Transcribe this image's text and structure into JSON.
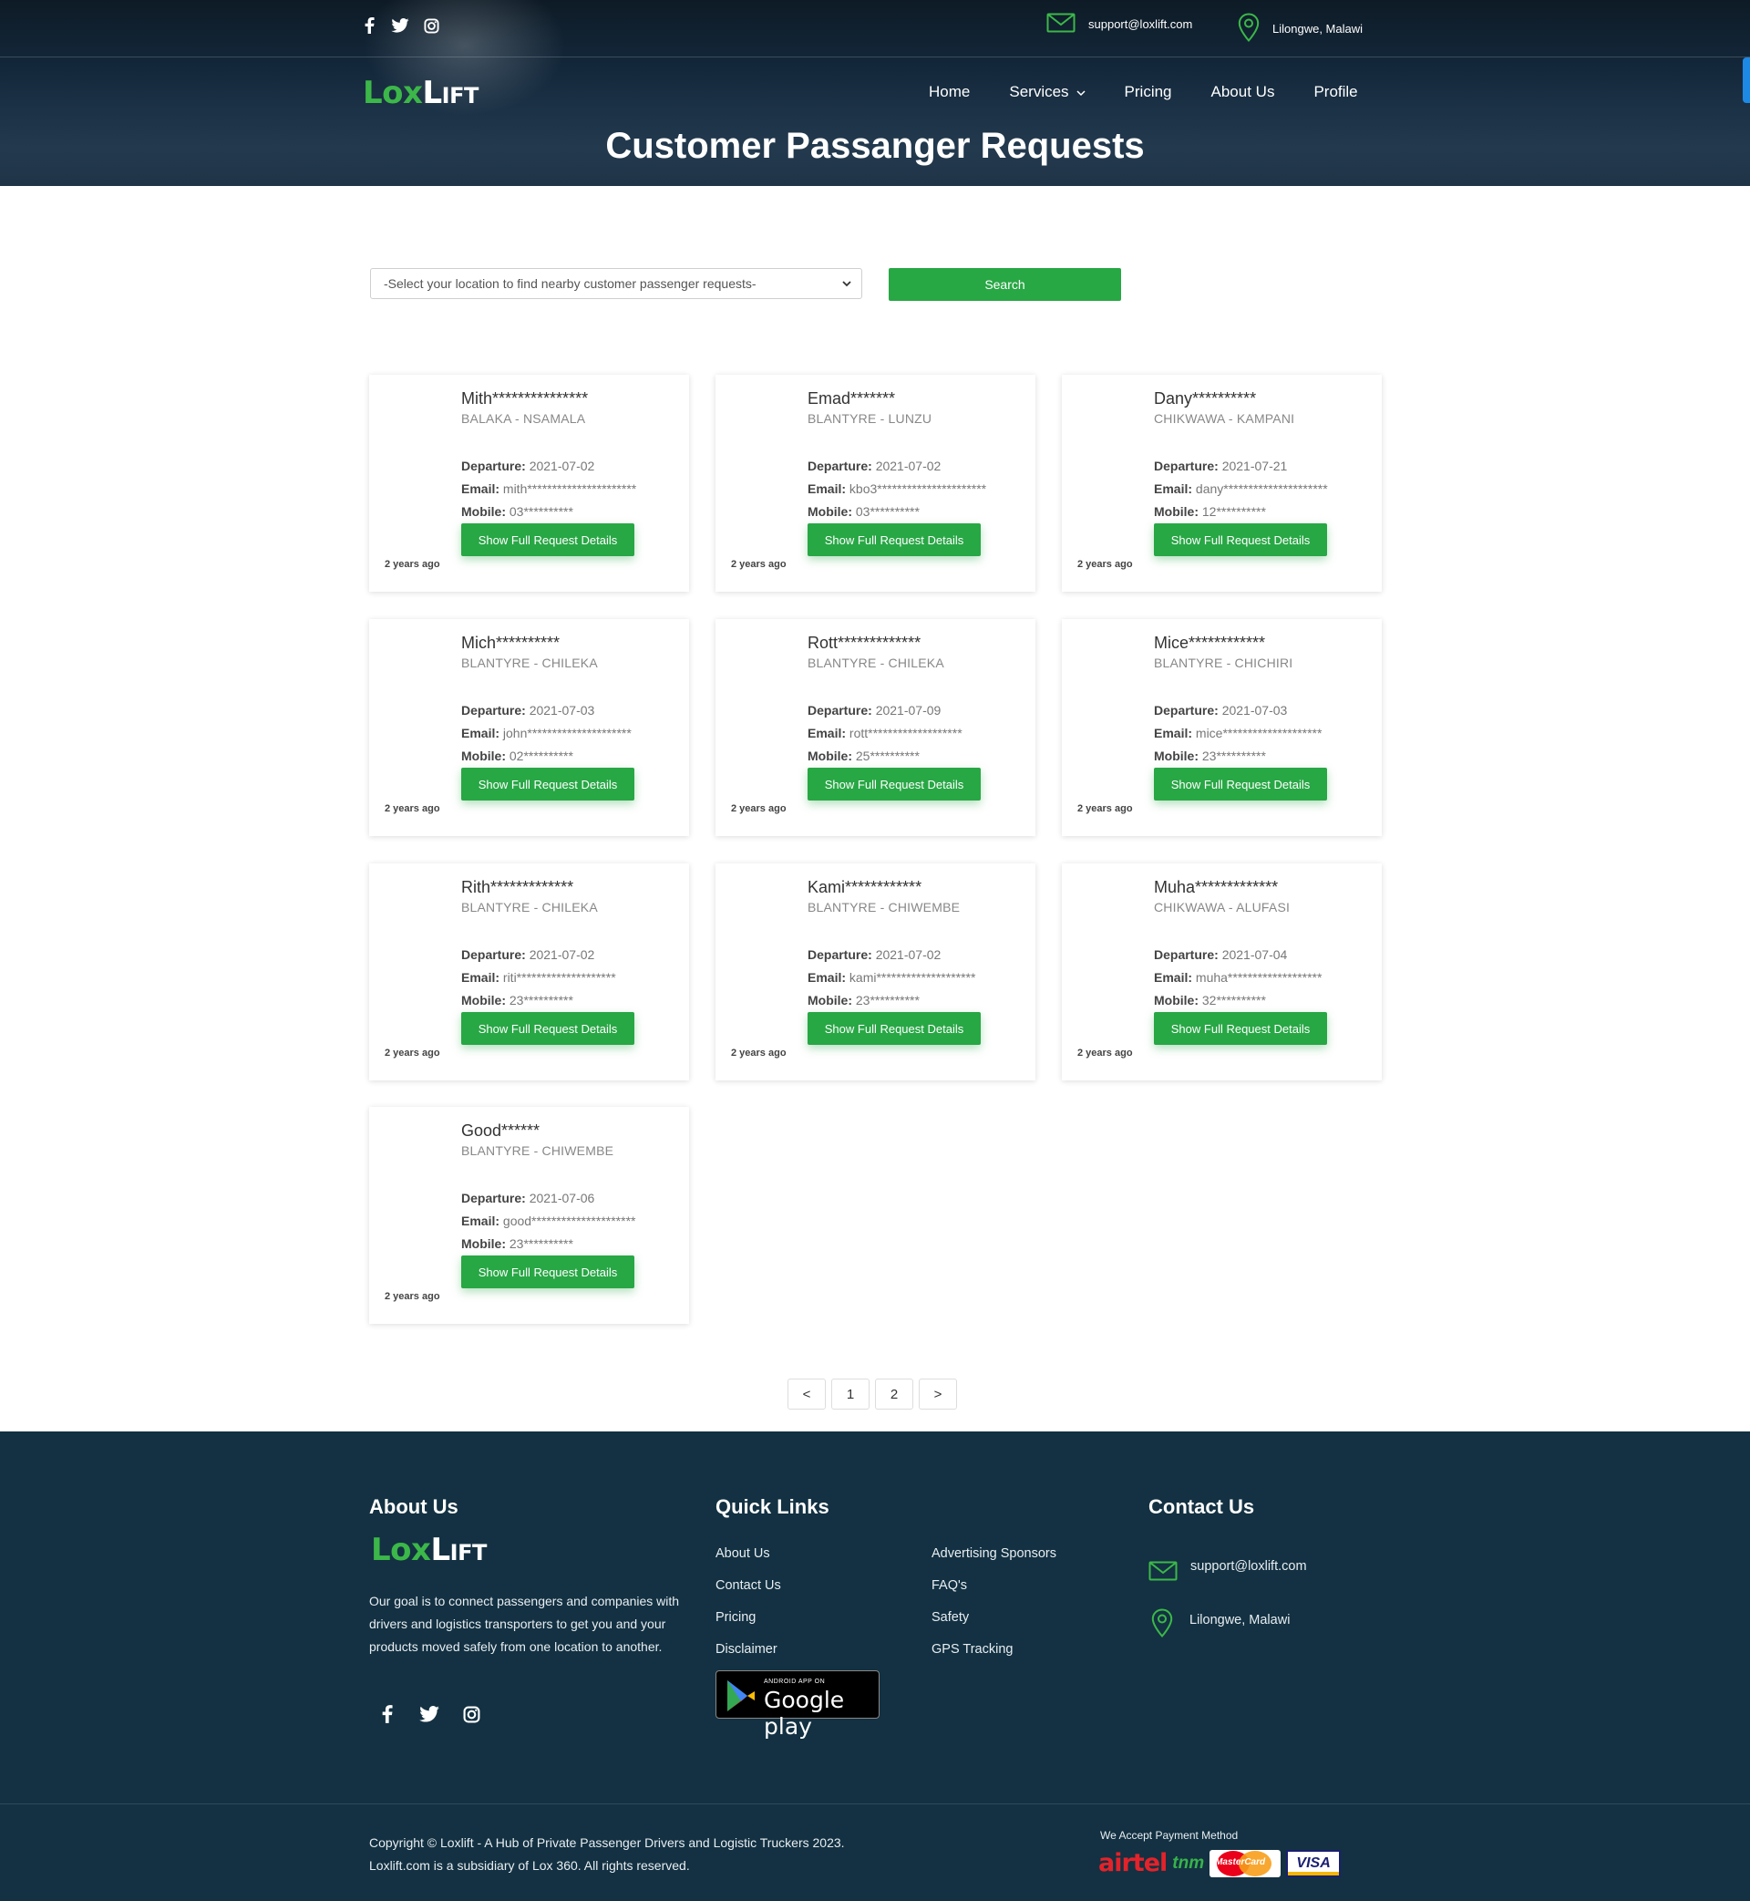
{
  "topbar": {
    "email": "support@loxlift.com",
    "location": "Lilongwe, Malawi",
    "social": [
      "facebook-icon",
      "twitter-icon",
      "instagram-icon"
    ]
  },
  "brand": {
    "lox": "Lox",
    "lift": "Lift"
  },
  "nav": {
    "home": "Home",
    "services": "Services",
    "pricing": "Pricing",
    "about": "About Us",
    "profile": "Profile"
  },
  "page": {
    "title": "Customer Passanger Requests"
  },
  "search": {
    "select_value": "-Select your location to find nearby customer passenger requests-",
    "button": "Search"
  },
  "labels": {
    "departure": "Departure:",
    "email": "Email:",
    "mobile": "Mobile:",
    "details_button": "Show Full Request Details"
  },
  "requests": [
    {
      "name": "Mith***************",
      "route": "BALAKA - NSAMALA",
      "departure": "2021-07-02",
      "email": "mith**********************",
      "mobile": "03**********",
      "ago": "2 years ago"
    },
    {
      "name": "Emad*******",
      "route": "BLANTYRE - LUNZU",
      "departure": "2021-07-02",
      "email": "kbo3**********************",
      "mobile": "03**********",
      "ago": "2 years ago"
    },
    {
      "name": "Dany**********",
      "route": "CHIKWAWA - KAMPANI",
      "departure": "2021-07-21",
      "email": "dany*********************",
      "mobile": "12**********",
      "ago": "2 years ago"
    },
    {
      "name": "Mich**********",
      "route": "BLANTYRE - CHILEKA",
      "departure": "2021-07-03",
      "email": "john*********************",
      "mobile": "02**********",
      "ago": "2 years ago"
    },
    {
      "name": "Rott*************",
      "route": "BLANTYRE - CHILEKA",
      "departure": "2021-07-09",
      "email": "rott*******************",
      "mobile": "25**********",
      "ago": "2 years ago"
    },
    {
      "name": "Mice************",
      "route": "BLANTYRE - CHICHIRI",
      "departure": "2021-07-03",
      "email": "mice********************",
      "mobile": "23**********",
      "ago": "2 years ago"
    },
    {
      "name": "Rith*************",
      "route": "BLANTYRE - CHILEKA",
      "departure": "2021-07-02",
      "email": "riti********************",
      "mobile": "23**********",
      "ago": "2 years ago"
    },
    {
      "name": "Kami************",
      "route": "BLANTYRE - CHIWEMBE",
      "departure": "2021-07-02",
      "email": "kami********************",
      "mobile": "23**********",
      "ago": "2 years ago"
    },
    {
      "name": "Muha*************",
      "route": "CHIKWAWA - ALUFASI",
      "departure": "2021-07-04",
      "email": "muha*******************",
      "mobile": "32**********",
      "ago": "2 years ago"
    },
    {
      "name": "Good******",
      "route": "BLANTYRE - CHIWEMBE",
      "departure": "2021-07-06",
      "email": "good*********************",
      "mobile": "23**********",
      "ago": "2 years ago"
    }
  ],
  "pagination": {
    "prev": "<",
    "pages": [
      "1",
      "2"
    ],
    "next": ">"
  },
  "footer": {
    "about_heading": "About Us",
    "about_text": "Our goal is to connect passengers and companies with drivers and logistics transporters to get you and your products moved safely from one location to another.",
    "quick_heading": "Quick Links",
    "quick_links": [
      "About Us",
      "Contact Us",
      "Pricing",
      "Disclaimer",
      "Advertising Sponsors",
      "FAQ's",
      "Safety",
      "GPS Tracking"
    ],
    "google_play": {
      "small": "ANDROID APP ON",
      "big": "Google play"
    },
    "contact_heading": "Contact Us",
    "contact_email": "support@loxlift.com",
    "contact_location": "Lilongwe, Malawi",
    "copyright_1": "Copyright © Loxlift - A Hub of Private Passenger Drivers and Logistic Truckers 2023.",
    "copyright_2": "Loxlift.com is a subsidiary of Lox 360. All rights reserved.",
    "payment_heading": "We Accept Payment Method",
    "payments": {
      "airtel": "airtel",
      "tnm": "tnm",
      "mastercard": "MasterCard",
      "visa": "VISA"
    }
  },
  "colors": {
    "accent_green": "#28a745",
    "logo_green": "#3cb749",
    "footer_bg": "#133142",
    "header_bg": "#13273a"
  }
}
